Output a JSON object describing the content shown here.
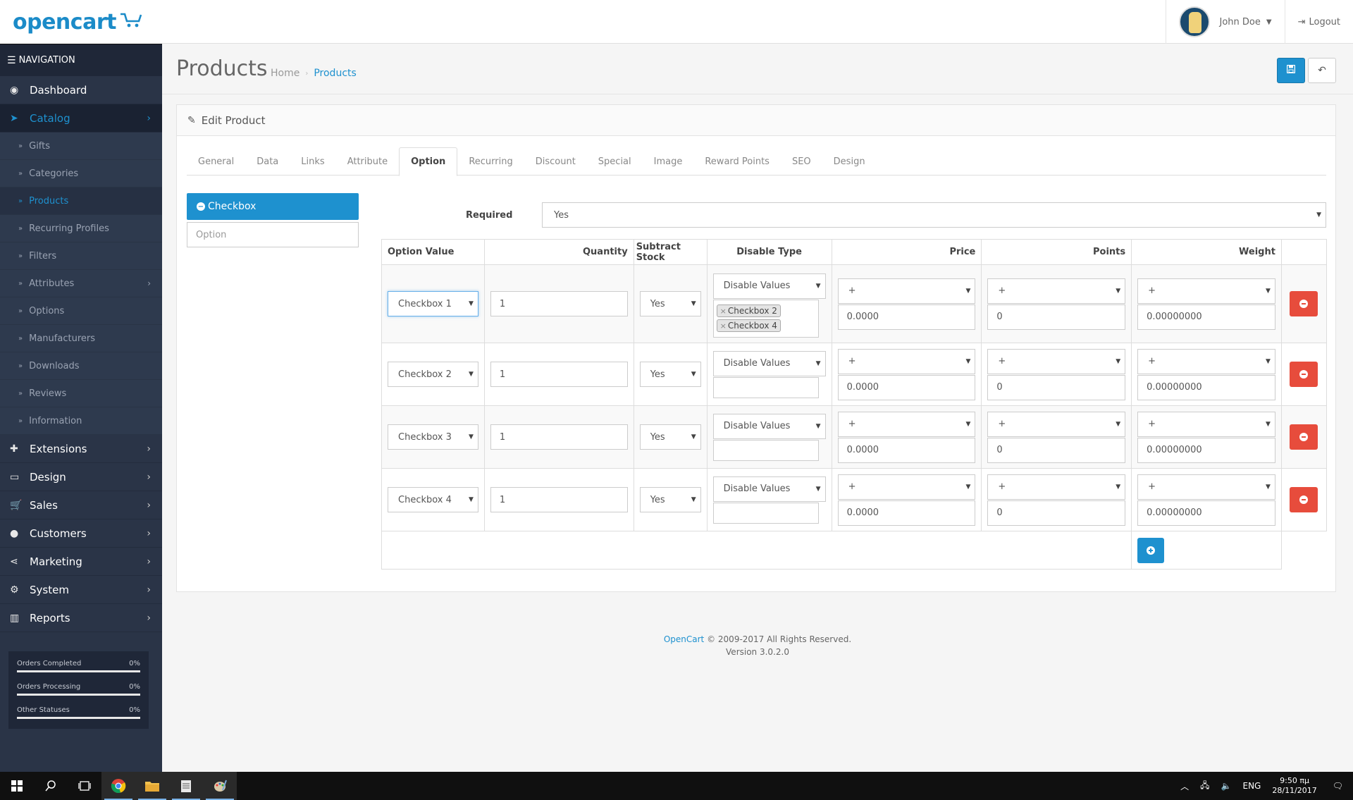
{
  "header": {
    "logo_text": "opencart",
    "logo_cart": "··🛒",
    "user_name": "John Doe",
    "logout_label": "Logout"
  },
  "sidebar": {
    "title": "NAVIGATION",
    "menu_top": [
      {
        "label": "Dashboard",
        "icon": "dashboard-icon"
      },
      {
        "label": "Catalog",
        "icon": "tag-icon"
      }
    ],
    "catalog_sub": [
      {
        "label": "Gifts"
      },
      {
        "label": "Categories"
      },
      {
        "label": "Products"
      },
      {
        "label": "Recurring Profiles"
      },
      {
        "label": "Filters"
      },
      {
        "label": "Attributes"
      },
      {
        "label": "Options"
      },
      {
        "label": "Manufacturers"
      },
      {
        "label": "Downloads"
      },
      {
        "label": "Reviews"
      },
      {
        "label": "Information"
      }
    ],
    "menu_bottom": [
      {
        "label": "Extensions",
        "icon": "puzzle-icon"
      },
      {
        "label": "Design",
        "icon": "monitor-icon"
      },
      {
        "label": "Sales",
        "icon": "cart-icon"
      },
      {
        "label": "Customers",
        "icon": "user-icon"
      },
      {
        "label": "Marketing",
        "icon": "share-icon"
      },
      {
        "label": "System",
        "icon": "gear-icon"
      },
      {
        "label": "Reports",
        "icon": "bar-chart-icon"
      }
    ],
    "stats": [
      {
        "label": "Orders Completed",
        "value": "0%",
        "fraction": 0
      },
      {
        "label": "Orders Processing",
        "value": "0%",
        "fraction": 0
      },
      {
        "label": "Other Statuses",
        "value": "0%",
        "fraction": 0
      }
    ]
  },
  "page": {
    "title": "Products",
    "breadcrumb": [
      "Home",
      "Products"
    ],
    "panel_title": "Edit Product"
  },
  "tabs": [
    "General",
    "Data",
    "Links",
    "Attribute",
    "Option",
    "Recurring",
    "Discount",
    "Special",
    "Image",
    "Reward Points",
    "SEO",
    "Design"
  ],
  "options": {
    "active_label": "Checkbox",
    "input_placeholder": "Option",
    "required_label": "Required",
    "required_value": "Yes"
  },
  "table": {
    "headers": {
      "option_value": "Option Value",
      "quantity": "Quantity",
      "subtract": "Subtract Stock",
      "disable_type": "Disable Type",
      "price": "Price",
      "points": "Points",
      "weight": "Weight"
    },
    "rows": [
      {
        "option_value": "Checkbox 1",
        "quantity": "1",
        "subtract": "Yes",
        "disable": "Disable Values",
        "tags": [
          "Checkbox 2",
          "Checkbox 4"
        ],
        "price_prefix": "+",
        "price": "0.0000",
        "points_prefix": "+",
        "points": "0",
        "weight_prefix": "+",
        "weight": "0.00000000"
      },
      {
        "option_value": "Checkbox 2",
        "quantity": "1",
        "subtract": "Yes",
        "disable": "Disable Values",
        "tags": [],
        "price_prefix": "+",
        "price": "0.0000",
        "points_prefix": "+",
        "points": "0",
        "weight_prefix": "+",
        "weight": "0.00000000"
      },
      {
        "option_value": "Checkbox 3",
        "quantity": "1",
        "subtract": "Yes",
        "disable": "Disable Values",
        "tags": [],
        "price_prefix": "+",
        "price": "0.0000",
        "points_prefix": "+",
        "points": "0",
        "weight_prefix": "+",
        "weight": "0.00000000"
      },
      {
        "option_value": "Checkbox 4",
        "quantity": "1",
        "subtract": "Yes",
        "disable": "Disable Values",
        "tags": [],
        "price_prefix": "+",
        "price": "0.0000",
        "points_prefix": "+",
        "points": "0",
        "weight_prefix": "+",
        "weight": "0.00000000"
      }
    ]
  },
  "footer": {
    "brand": "OpenCart",
    "copyright": "© 2009-2017 All Rights Reserved.",
    "version": "Version 3.0.2.0"
  },
  "taskbar": {
    "apps": [
      "windows-start-icon",
      "search-icon",
      "task-view-icon",
      "chrome-icon",
      "file-explorer-icon",
      "notepad-icon",
      "paint-icon"
    ],
    "language": "ENG",
    "time": "9:50 πμ",
    "date": "28/11/2017"
  },
  "colors": {
    "accent": "#1e91cf",
    "sidebar": "#2a3447",
    "danger": "#e74c3c"
  }
}
